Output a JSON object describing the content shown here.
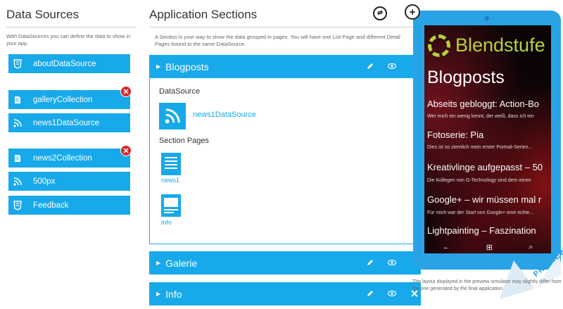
{
  "data_sources": {
    "title": "Data Sources",
    "description": "With DataSources you can define the data to show in your app.",
    "items": [
      {
        "label": "aboutDataSource",
        "icon": "html5-icon"
      },
      {
        "label": "galleryCollection",
        "icon": "collection-icon"
      },
      {
        "label": "news1DataSource",
        "icon": "rss-icon"
      },
      {
        "label": "news2Collection",
        "icon": "collection-icon"
      },
      {
        "label": "500px",
        "icon": "rss-icon"
      },
      {
        "label": "Feedback",
        "icon": "html5-icon"
      }
    ],
    "delete_mark": "✕"
  },
  "app_sections": {
    "title": "Application Sections",
    "description": "A Section is your way to show the data grouped in pages. You will have one List Page and different Detail Pages bound to the same DataSource.",
    "refresh_icon": "refresh-icon",
    "add_icon": "plus-icon",
    "sections": [
      {
        "label": "Blogposts"
      },
      {
        "label": "Galerie"
      },
      {
        "label": "Info"
      }
    ],
    "expanded": {
      "datasource_label": "DataSource",
      "datasource_name": "news1DataSource",
      "pages_label": "Section Pages",
      "pages": [
        {
          "label": "news1"
        },
        {
          "label": "Info"
        }
      ]
    }
  },
  "phone": {
    "logo_text": "Blendstufe",
    "header": "Blogposts",
    "posts": [
      {
        "title": "Abseits gebloggt: Action-Bo",
        "sub": "Wer mich ein wenig kennt, der weiß, dass ich ein"
      },
      {
        "title": "Fotoserie: Pia",
        "sub": "Dies ist so ziemlich mein erster Portrait-Serien..."
      },
      {
        "title": "Kreativlinge aufgepasst – 50",
        "sub": "Die Kollegen von G-Technology sind dem einen"
      },
      {
        "title": "Google+ – wir müssen mal r",
        "sub": "Für mich war der Start von Google+ eine echte..."
      },
      {
        "title": "Lightpainting – Faszination",
        "sub": ""
      }
    ],
    "nav": [
      "←",
      "⊞",
      "⌕"
    ]
  },
  "preview_stamp": "PREVIEW",
  "simulator_note": "The layout displayed in the preview simulator may slightly differ from the one generated by the final application.",
  "colors": {
    "accent": "#17a9ea",
    "phone": "#29a3e6",
    "delete": "#d9262c",
    "logo": "#b5d23a"
  }
}
